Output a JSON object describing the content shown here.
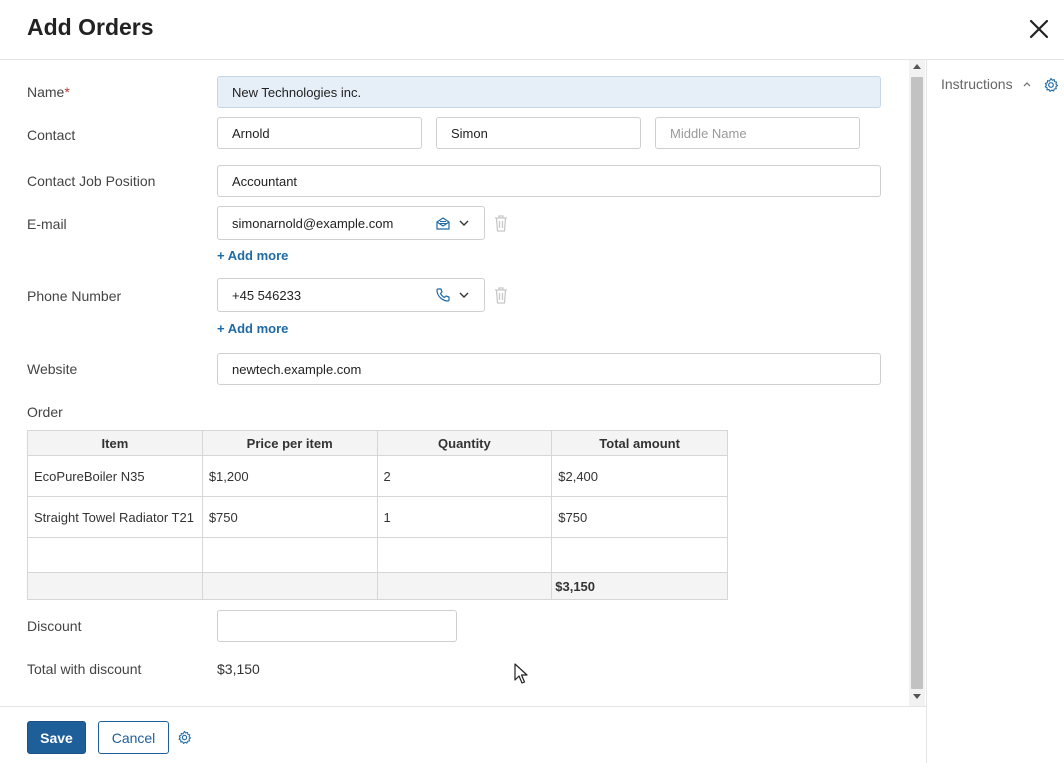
{
  "header": {
    "title": "Add Orders"
  },
  "form": {
    "name_label": "Name",
    "name_required": "*",
    "name_value": "New Technologies inc.",
    "contact_label": "Contact",
    "contact_first": "Arnold",
    "contact_last": "Simon",
    "contact_middle_placeholder": "Middle Name",
    "job_label": "Contact Job Position",
    "job_value": "Accountant",
    "email_label": "E-mail",
    "email_value": "simonarnold@example.com",
    "add_more": "+ Add more",
    "phone_label": "Phone Number",
    "phone_value": "+45 546233",
    "website_label": "Website",
    "website_value": "newtech.example.com",
    "order_label": "Order",
    "discount_label": "Discount",
    "discount_value": "",
    "total_label": "Total with discount",
    "total_value": "$3,150"
  },
  "order_table": {
    "headers": [
      "Item",
      "Price per item",
      "Quantity",
      "Total amount"
    ],
    "rows": [
      [
        "EcoPureBoiler N35",
        "$1,200",
        "2",
        "$2,400"
      ],
      [
        "Straight Towel Radiator T21",
        "$750",
        "1",
        "$750"
      ],
      [
        "",
        "",
        "",
        ""
      ]
    ],
    "total": "$3,150"
  },
  "side": {
    "title": "Instructions"
  },
  "footer": {
    "save": "Save",
    "cancel": "Cancel"
  },
  "colors": {
    "accent": "#1f5f99",
    "link": "#1f6aa5",
    "required": "#c0392b",
    "name_field_bg": "#e6eef7"
  },
  "icons": [
    "close-icon",
    "envelope-icon",
    "phone-icon",
    "chevron-down-icon",
    "trash-icon",
    "gear-icon",
    "chevron-up-icon",
    "mouse-cursor-icon"
  ]
}
